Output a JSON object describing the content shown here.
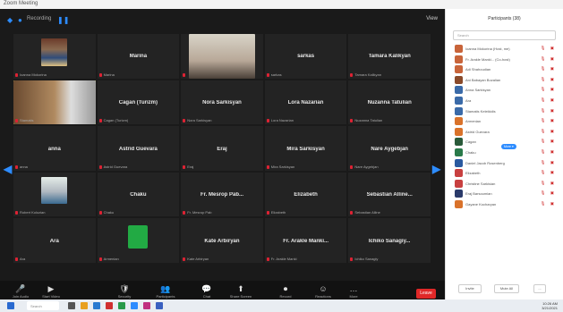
{
  "window": {
    "title": "Zoom Meeting"
  },
  "meeting": {
    "top_label": "Recording",
    "view_label": "View",
    "tiles": [
      {
        "name": "",
        "caption": "Ioanna Mokorina",
        "image": "p1",
        "active": false
      },
      {
        "name": "Marina",
        "caption": "Marina",
        "image": "",
        "active": false
      },
      {
        "name": "",
        "caption": "",
        "image": "p3",
        "active": false
      },
      {
        "name": "sarkas",
        "caption": "sarkas",
        "image": "",
        "active": false
      },
      {
        "name": "Tamara Kalikyan",
        "caption": "Tamara Kalikyan",
        "image": "",
        "active": false
      },
      {
        "name": "",
        "caption": "Stamatis",
        "image": "p2",
        "active": true
      },
      {
        "name": "Cagan (Turizm)",
        "caption": "Cagan (Turizm)",
        "image": "",
        "active": false
      },
      {
        "name": "Nora Sarkisyan",
        "caption": "Nora Sarkisyan",
        "image": "",
        "active": false
      },
      {
        "name": "Lora Nazarian",
        "caption": "Lora Nazarian",
        "image": "",
        "active": false
      },
      {
        "name": "Nuzanna Tatulian",
        "caption": "Nuzanna Tatulian",
        "image": "",
        "active": false
      },
      {
        "name": "anna",
        "caption": "anna",
        "image": "",
        "active": false
      },
      {
        "name": "Astrid Guevara",
        "caption": "Astrid Guevara",
        "image": "",
        "active": false
      },
      {
        "name": "Eraj",
        "caption": "Eraj",
        "image": "",
        "active": false
      },
      {
        "name": "Mira Sarkisyan",
        "caption": "Mira Sarkisyan",
        "image": "",
        "active": false
      },
      {
        "name": "Nare Aygebjan",
        "caption": "Nare Aygebjan",
        "image": "",
        "active": false
      },
      {
        "name": "",
        "caption": "Robert Kolozian",
        "image": "p4",
        "active": false
      },
      {
        "name": "Chaku",
        "caption": "Chaku",
        "image": "",
        "active": false
      },
      {
        "name": "Fr. Mesrop Pab...",
        "caption": "Fr. Mesrop Pab",
        "image": "",
        "active": false
      },
      {
        "name": "Elizabeth",
        "caption": "Elizabeth",
        "image": "",
        "active": false
      },
      {
        "name": "Sebastian Alline...",
        "caption": "Sebastian Alline",
        "image": "",
        "active": false
      },
      {
        "name": "Ara",
        "caption": "Ara",
        "image": "",
        "active": false
      },
      {
        "name": "",
        "caption": "Armenian",
        "image": "p5",
        "active": false
      },
      {
        "name": "Kate Arbiryan",
        "caption": "Kate Arbiryan",
        "image": "",
        "active": false
      },
      {
        "name": "Fr. Arakle Manki...",
        "caption": "Fr. Arakle Manki",
        "image": "",
        "active": false
      },
      {
        "name": "Ichiko Sanagiy...",
        "caption": "Ichiko Sanagiy",
        "image": "",
        "active": false
      }
    ]
  },
  "toolbar": {
    "buttons": [
      {
        "glyph": "🎤",
        "label": "Join Audio",
        "icon": "microphone-icon"
      },
      {
        "glyph": "▶",
        "label": "Start Video",
        "icon": "video-icon"
      },
      {
        "glyph": "🛡",
        "label": "Security",
        "icon": "shield-icon"
      },
      {
        "glyph": "👥",
        "label": "Participants",
        "icon": "participants-icon"
      },
      {
        "glyph": "💬",
        "label": "Chat",
        "icon": "chat-icon"
      },
      {
        "glyph": "⬆",
        "label": "Share Screen",
        "icon": "share-screen-icon"
      },
      {
        "glyph": "⏺",
        "label": "Record",
        "icon": "record-icon"
      },
      {
        "glyph": "☺",
        "label": "Reactions",
        "icon": "reactions-icon"
      },
      {
        "glyph": "…",
        "label": "More",
        "icon": "more-icon"
      }
    ],
    "leave_label": "Leave"
  },
  "panel": {
    "title": "Participants (38)",
    "search_placeholder": "Search",
    "participants": [
      {
        "name": "Ioanna Mokorina (Host, me)",
        "color": "#c8643a"
      },
      {
        "name": "Fr. Arakle Manki... (Co-host)",
        "color": "#c8643a"
      },
      {
        "name": "Adi Shahoudian",
        "color": "#c8643a"
      },
      {
        "name": "Ani Babayan Bozalian",
        "color": "#8a4a2a"
      },
      {
        "name": "Anna Sarkisyan",
        "color": "#3a6aa8"
      },
      {
        "name": "Ara",
        "color": "#3a6aa8"
      },
      {
        "name": "Stamatis Keleikidis",
        "color": "#3a6aa8"
      },
      {
        "name": "Armenian",
        "color": "#d9722a"
      },
      {
        "name": "Astrid Guevara",
        "color": "#d9722a"
      },
      {
        "name": "Cagan",
        "color": "#2a5a3a"
      },
      {
        "name": "Chaku",
        "color": "#2a7a4a"
      },
      {
        "name": "Daniel Jacob Rosenberg",
        "color": "#2a5aa0"
      },
      {
        "name": "Elizabeth",
        "color": "#c84040"
      },
      {
        "name": "Christine Sarkisian",
        "color": "#c84040"
      },
      {
        "name": "Eraj Barsoumian",
        "color": "#2a3a6a"
      },
      {
        "name": "Gayane Kocharyan",
        "color": "#d9722a"
      }
    ],
    "hover_tag": "More ▾",
    "footer": {
      "invite": "Invite",
      "mute_all": "Mute All",
      "more": "..."
    }
  },
  "taskbar": {
    "search_placeholder": "Search",
    "time": "10:26 AM",
    "date": "3/21/2021"
  }
}
